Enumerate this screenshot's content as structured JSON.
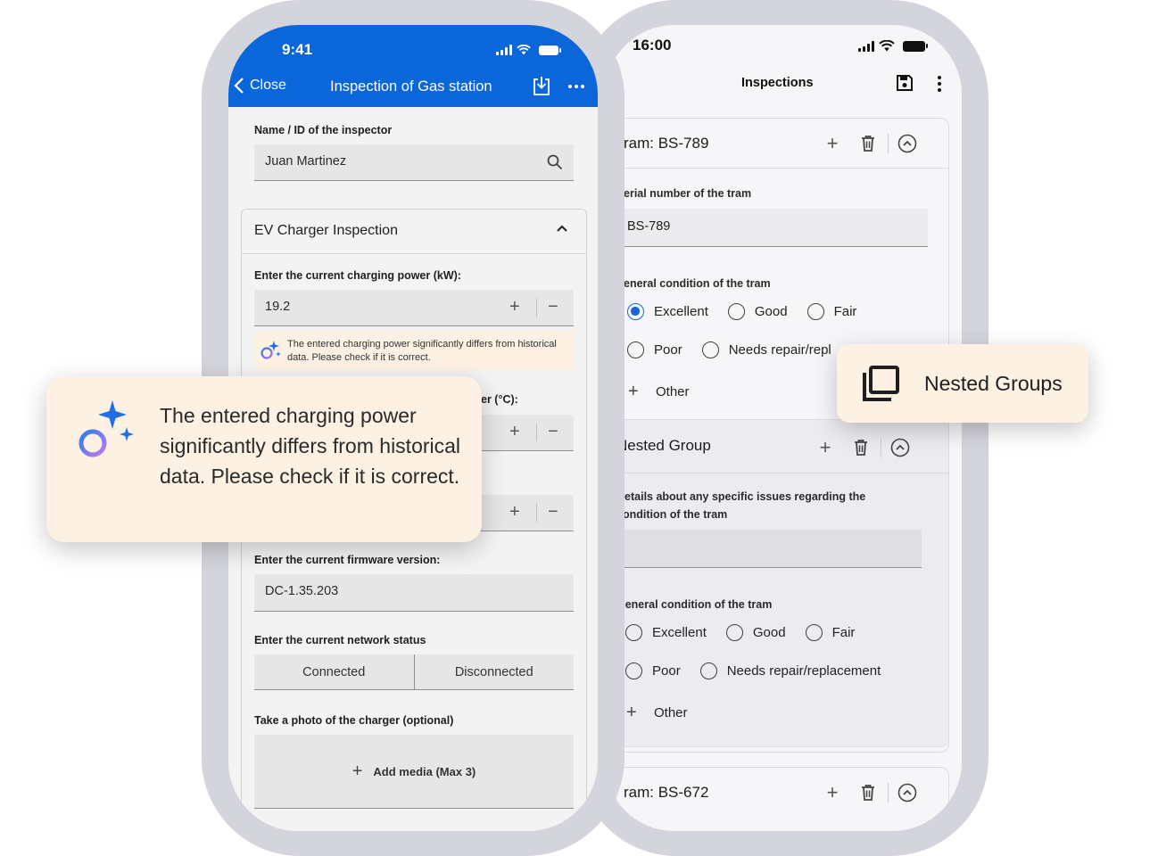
{
  "phone_left": {
    "status_time": "9:41",
    "nav": {
      "close_label": "Close",
      "title": "Inspection of Gas station"
    },
    "inspector": {
      "label": "Name / ID of the inspector",
      "value": "Juan Martinez"
    },
    "ev_section": {
      "title": "EV Charger Inspection"
    },
    "charging_power": {
      "label": "Enter the current charging power (kW):",
      "value": "19.2"
    },
    "hint": "The entered charging power significantly differs from historical data. Please check if it is correct.",
    "temperature_label_fragment": "er (°C):",
    "firmware": {
      "label": "Enter the current firmware version:",
      "value": "DC-1.35.203"
    },
    "network": {
      "label": "Enter the current network status",
      "options": [
        "Connected",
        "Disconnected"
      ]
    },
    "photo": {
      "label": "Take a photo of the charger (optional)",
      "button": "Add media (Max 3)"
    }
  },
  "phone_right": {
    "status_time": "16:00",
    "title": "Inspections",
    "tram1": {
      "name": "ram: BS-789",
      "serial_label": "erial number of the tram",
      "serial_value": "BS-789",
      "condition_label": "eneral condition of the tram",
      "options_row1": [
        "Excellent",
        "Good",
        "Fair"
      ],
      "options_row2": [
        "Poor",
        "Needs repair/repl"
      ],
      "other_label": "Other"
    },
    "nested": {
      "title": "Nested Group",
      "details_label_line1": "Details about any specific issues regarding the",
      "details_label_line2": "condition of the tram",
      "condition_label": "General condition of the tram",
      "options_row1": [
        "Excellent",
        "Good",
        "Fair"
      ],
      "options_row2": [
        "Poor",
        "Needs repair/replacement"
      ],
      "other_label": "Other"
    },
    "tram2": {
      "name": "ram: BS-672"
    }
  },
  "callout": {
    "text": "The entered charging power significantly differs from historical data. Please check if it is correct."
  },
  "feature_badge": {
    "label": "Nested Groups"
  },
  "colors": {
    "primary_blue": "#0b66d9",
    "hint_bg": "#fcf1e2",
    "radio_selected": "#1b63d6"
  }
}
